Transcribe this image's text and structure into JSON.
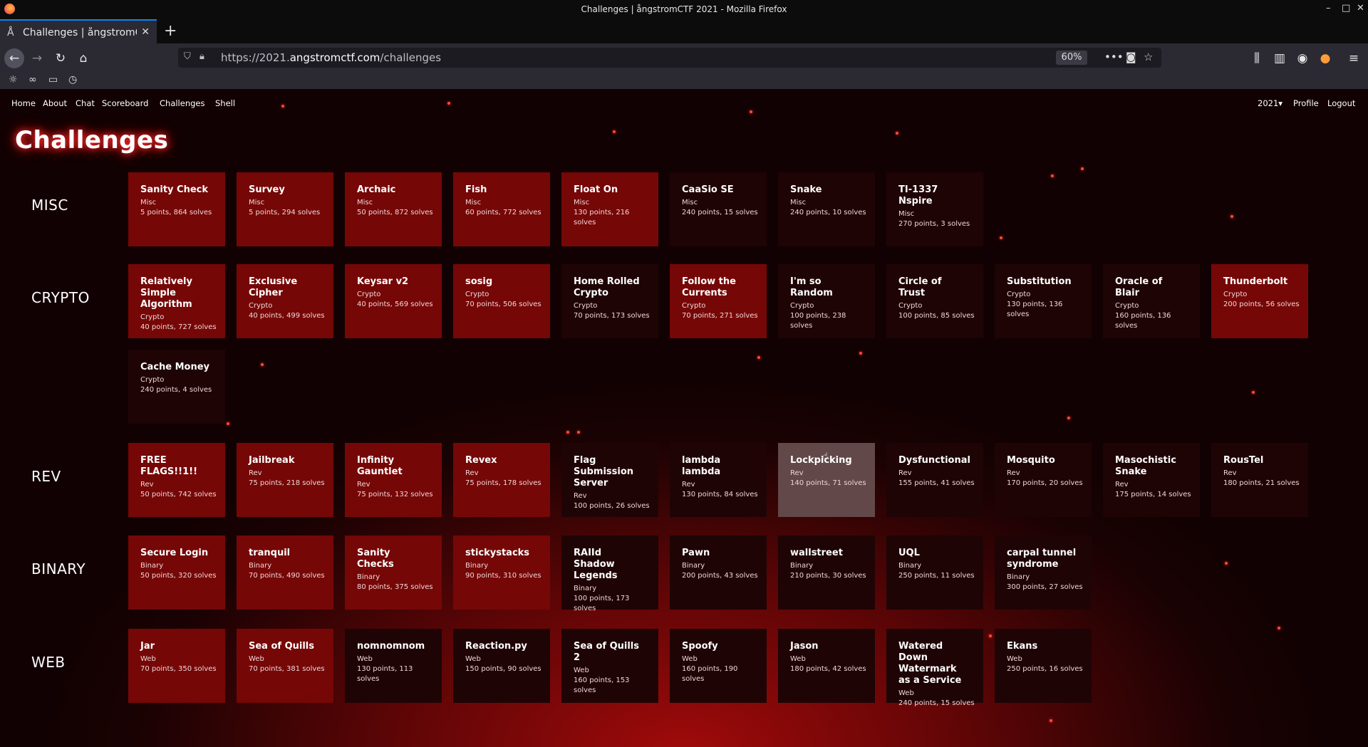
{
  "window": {
    "title": "Challenges | ångstromCTF 2021 - Mozilla Firefox"
  },
  "browser": {
    "tab_title": "Challenges | ångstromCTF 2021",
    "url_prefix": "https://2021.",
    "url_domain": "angstromctf.com",
    "url_path": "/challenges",
    "zoom": "60%"
  },
  "site": {
    "nav_left": [
      "Home",
      "About",
      "Chat",
      "Scoreboard",
      "Challenges",
      "Shell"
    ],
    "year_menu": "2021▾",
    "profile": "Profile",
    "logout": "Logout",
    "page_title": "Challenges"
  },
  "categories": [
    "MISC",
    "CRYPTO",
    "REV",
    "BINARY",
    "WEB"
  ],
  "challenges": {
    "misc": [
      {
        "name": "Sanity Check",
        "cat": "Misc",
        "info": "5 points, 864 solves",
        "state": "solved"
      },
      {
        "name": "Survey",
        "cat": "Misc",
        "info": "5 points, 294 solves",
        "state": "solved"
      },
      {
        "name": "Archaic",
        "cat": "Misc",
        "info": "50 points, 872 solves",
        "state": "solved"
      },
      {
        "name": "Fish",
        "cat": "Misc",
        "info": "60 points, 772 solves",
        "state": "solved"
      },
      {
        "name": "Float On",
        "cat": "Misc",
        "info": "130 points, 216 solves",
        "state": "solved"
      },
      {
        "name": "CaaSio SE",
        "cat": "Misc",
        "info": "240 points, 15 solves",
        "state": "unsolved"
      },
      {
        "name": "Snake",
        "cat": "Misc",
        "info": "240 points, 10 solves",
        "state": "unsolved"
      },
      {
        "name": "TI-1337 Nspire",
        "cat": "Misc",
        "info": "270 points, 3 solves",
        "state": "unsolved"
      }
    ],
    "crypto": [
      {
        "name": "Relatively Simple Algorithm",
        "cat": "Crypto",
        "info": "40 points, 727 solves",
        "state": "solved"
      },
      {
        "name": "Exclusive Cipher",
        "cat": "Crypto",
        "info": "40 points, 499 solves",
        "state": "solved"
      },
      {
        "name": "Keysar v2",
        "cat": "Crypto",
        "info": "40 points, 569 solves",
        "state": "solved"
      },
      {
        "name": "sosig",
        "cat": "Crypto",
        "info": "70 points, 506 solves",
        "state": "solved"
      },
      {
        "name": "Home Rolled Crypto",
        "cat": "Crypto",
        "info": "70 points, 173 solves",
        "state": "unsolved"
      },
      {
        "name": "Follow the Currents",
        "cat": "Crypto",
        "info": "70 points, 271 solves",
        "state": "solved"
      },
      {
        "name": "I'm so Random",
        "cat": "Crypto",
        "info": "100 points, 238 solves",
        "state": "unsolved"
      },
      {
        "name": "Circle of Trust",
        "cat": "Crypto",
        "info": "100 points, 85 solves",
        "state": "unsolved"
      },
      {
        "name": "Substitution",
        "cat": "Crypto",
        "info": "130 points, 136 solves",
        "state": "unsolved"
      },
      {
        "name": "Oracle of Blair",
        "cat": "Crypto",
        "info": "160 points, 136 solves",
        "state": "unsolved"
      },
      {
        "name": "Thunderbolt",
        "cat": "Crypto",
        "info": "200 points, 56 solves",
        "state": "solved"
      },
      {
        "name": "Cache Money",
        "cat": "Crypto",
        "info": "240 points, 4 solves",
        "state": "unsolved"
      }
    ],
    "rev": [
      {
        "name": "FREE FLAGS!!1!!",
        "cat": "Rev",
        "info": "50 points, 742 solves",
        "state": "solved"
      },
      {
        "name": "Jailbreak",
        "cat": "Rev",
        "info": "75 points, 218 solves",
        "state": "solved"
      },
      {
        "name": "Infinity Gauntlet",
        "cat": "Rev",
        "info": "75 points, 132 solves",
        "state": "solved"
      },
      {
        "name": "Revex",
        "cat": "Rev",
        "info": "75 points, 178 solves",
        "state": "solved"
      },
      {
        "name": "Flag Submission Server",
        "cat": "Rev",
        "info": "100 points, 26 solves",
        "state": "unsolved"
      },
      {
        "name": "lambda lambda",
        "cat": "Rev",
        "info": "130 points, 84 solves",
        "state": "unsolved"
      },
      {
        "name": "Lockpicking",
        "cat": "Rev",
        "info": "140 points, 71 solves",
        "state": "hover"
      },
      {
        "name": "Dysfunctional",
        "cat": "Rev",
        "info": "155 points, 41 solves",
        "state": "unsolved"
      },
      {
        "name": "Mosquito",
        "cat": "Rev",
        "info": "170 points, 20 solves",
        "state": "unsolved"
      },
      {
        "name": "Masochistic Snake",
        "cat": "Rev",
        "info": "175 points, 14 solves",
        "state": "unsolved"
      },
      {
        "name": "RousTel",
        "cat": "Rev",
        "info": "180 points, 21 solves",
        "state": "unsolved"
      }
    ],
    "binary": [
      {
        "name": "Secure Login",
        "cat": "Binary",
        "info": "50 points, 320 solves",
        "state": "solved"
      },
      {
        "name": "tranquil",
        "cat": "Binary",
        "info": "70 points, 490 solves",
        "state": "solved"
      },
      {
        "name": "Sanity Checks",
        "cat": "Binary",
        "info": "80 points, 375 solves",
        "state": "solved"
      },
      {
        "name": "stickystacks",
        "cat": "Binary",
        "info": "90 points, 310 solves",
        "state": "solved"
      },
      {
        "name": "RAIId Shadow Legends",
        "cat": "Binary",
        "info": "100 points, 173 solves",
        "state": "unsolved"
      },
      {
        "name": "Pawn",
        "cat": "Binary",
        "info": "200 points, 43 solves",
        "state": "unsolved"
      },
      {
        "name": "wallstreet",
        "cat": "Binary",
        "info": "210 points, 30 solves",
        "state": "unsolved"
      },
      {
        "name": "UQL",
        "cat": "Binary",
        "info": "250 points, 11 solves",
        "state": "unsolved"
      },
      {
        "name": "carpal tunnel syndrome",
        "cat": "Binary",
        "info": "300 points, 27 solves",
        "state": "unsolved"
      }
    ],
    "web": [
      {
        "name": "Jar",
        "cat": "Web",
        "info": "70 points, 350 solves",
        "state": "solved"
      },
      {
        "name": "Sea of Quills",
        "cat": "Web",
        "info": "70 points, 381 solves",
        "state": "solved"
      },
      {
        "name": "nomnomnom",
        "cat": "Web",
        "info": "130 points, 113 solves",
        "state": "unsolved"
      },
      {
        "name": "Reaction.py",
        "cat": "Web",
        "info": "150 points, 90 solves",
        "state": "unsolved"
      },
      {
        "name": "Sea of Quills 2",
        "cat": "Web",
        "info": "160 points, 153 solves",
        "state": "unsolved"
      },
      {
        "name": "Spoofy",
        "cat": "Web",
        "info": "160 points, 190 solves",
        "state": "unsolved"
      },
      {
        "name": "Jason",
        "cat": "Web",
        "info": "180 points, 42 solves",
        "state": "unsolved"
      },
      {
        "name": "Watered Down Watermark as a Service",
        "cat": "Web",
        "info": "240 points, 15 solves",
        "state": "unsolved"
      },
      {
        "name": "Ekans",
        "cat": "Web",
        "info": "250 points, 16 solves",
        "state": "unsolved"
      }
    ]
  },
  "colors": {
    "solved": "#760707",
    "unsolved": "#1f0405",
    "hover": "#624848",
    "accent": "#ff2a2a"
  }
}
